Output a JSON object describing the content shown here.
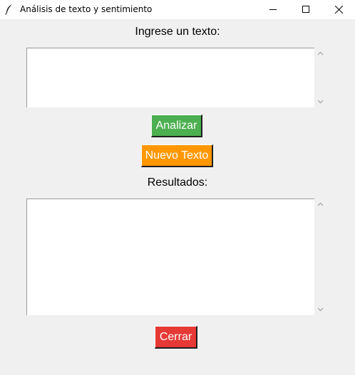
{
  "window": {
    "title": "Análisis de texto y sentimiento",
    "icon": "feather-icon",
    "controls": [
      "minimize-icon",
      "maximize-icon",
      "close-icon"
    ]
  },
  "input": {
    "label": "Ingrese un texto:",
    "value": ""
  },
  "buttons": {
    "analyze": "Analizar",
    "new_text": "Nuevo Texto",
    "close": "Cerrar"
  },
  "results": {
    "label": "Resultados:",
    "value": ""
  },
  "colors": {
    "analyze": "#4caf50",
    "new_text": "#ff9800",
    "close": "#e53935",
    "background": "#f0f0f0"
  }
}
